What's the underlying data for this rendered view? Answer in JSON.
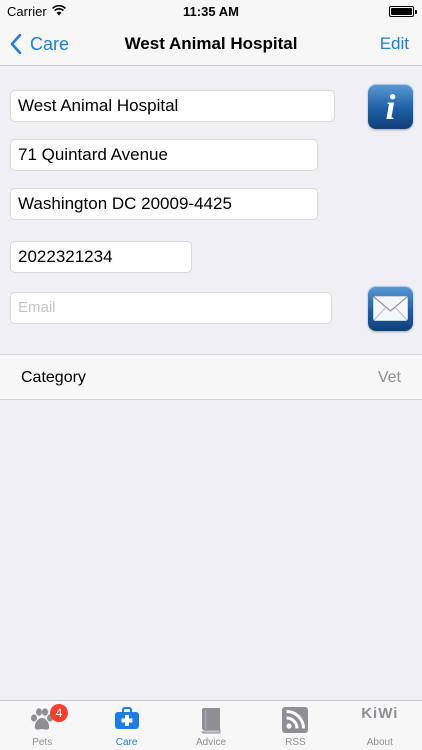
{
  "status": {
    "carrier": "Carrier",
    "time": "11:35 AM"
  },
  "nav": {
    "back_label": "Care",
    "title": "West Animal Hospital",
    "edit_label": "Edit"
  },
  "form": {
    "name": "West Animal Hospital",
    "street": "71 Quintard Avenue",
    "city": "Washington DC 20009-4425",
    "phone": "2022321234",
    "email_placeholder": "Email",
    "info_icon": "info-icon",
    "mail_icon": "mail-icon"
  },
  "category": {
    "label": "Category",
    "value": "Vet"
  },
  "tabs": [
    {
      "label": "Pets",
      "icon": "paw-icon",
      "badge": "4"
    },
    {
      "label": "Care",
      "icon": "medical-kit-icon",
      "active": true
    },
    {
      "label": "Advice",
      "icon": "book-icon"
    },
    {
      "label": "RSS",
      "icon": "rss-icon"
    },
    {
      "label": "About",
      "icon": "kiwi-logo",
      "logo_text": "KiWi"
    }
  ],
  "colors": {
    "accent": "#1a7ee5",
    "badge": "#ff3b30",
    "inactive": "#8e8e93"
  }
}
